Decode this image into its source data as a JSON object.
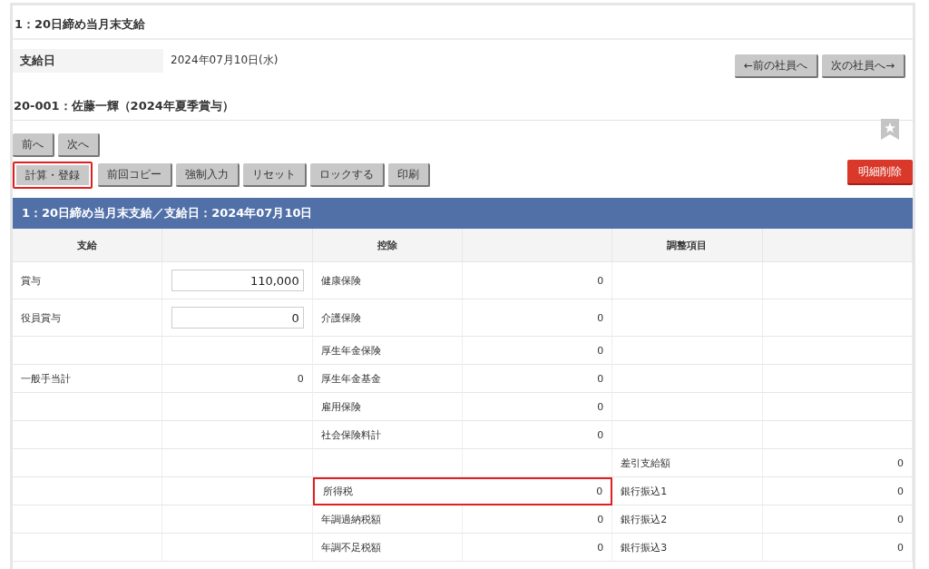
{
  "section_title": "1：20日締め当月末支給",
  "pay_date": {
    "label": "支給日",
    "value": "2024年07月10日(水)"
  },
  "employee_nav": [
    "←前の社員へ",
    "次の社員へ→"
  ],
  "employee_title": "20-001：佐藤一輝（2024年夏季賞与）",
  "page_nav": [
    "前へ",
    "次へ"
  ],
  "actions": [
    {
      "label": "計算・登録",
      "highlighted": true
    },
    {
      "label": "前回コピー",
      "highlighted": false
    },
    {
      "label": "強制入力",
      "highlighted": false
    },
    {
      "label": "リセット",
      "highlighted": false
    },
    {
      "label": "ロックする",
      "highlighted": false
    },
    {
      "label": "印刷",
      "highlighted": false
    }
  ],
  "delete_button": "明細削除",
  "table": {
    "title": "1：20日締め当月末支給／支給日：2024年07月10日",
    "headers": [
      "支給",
      "控除",
      "調整項目"
    ],
    "rows": [
      {
        "cells": [
          {
            "label": "賞与",
            "value": "110,000",
            "kind": "input",
            "highlighted": false
          },
          {
            "label": "健康保険",
            "value": "0",
            "kind": "text",
            "highlighted": false
          },
          {}
        ]
      },
      {
        "cells": [
          {
            "label": "役員賞与",
            "value": "0",
            "kind": "input",
            "highlighted": false
          },
          {
            "label": "介護保険",
            "value": "0",
            "kind": "text",
            "highlighted": false
          },
          {}
        ]
      },
      {
        "cells": [
          {},
          {
            "label": "厚生年金保険",
            "value": "0",
            "kind": "text",
            "highlighted": false
          },
          {}
        ]
      },
      {
        "cells": [
          {
            "label": "一般手当計",
            "value": "0",
            "kind": "text",
            "highlighted": false
          },
          {
            "label": "厚生年金基金",
            "value": "0",
            "kind": "text",
            "highlighted": false
          },
          {}
        ]
      },
      {
        "cells": [
          {},
          {
            "label": "雇用保険",
            "value": "0",
            "kind": "text",
            "highlighted": false
          },
          {}
        ]
      },
      {
        "cells": [
          {},
          {
            "label": "社会保険料計",
            "value": "0",
            "kind": "text",
            "highlighted": false
          },
          {}
        ]
      },
      {
        "cells": [
          {},
          {},
          {
            "label": "差引支給額",
            "value": "0",
            "kind": "text",
            "highlighted": false
          }
        ]
      },
      {
        "cells": [
          {},
          {
            "label": "所得税",
            "value": "0",
            "kind": "text",
            "highlighted": true
          },
          {
            "label": "銀行振込1",
            "value": "0",
            "kind": "text",
            "highlighted": false
          }
        ]
      },
      {
        "cells": [
          {},
          {
            "label": "年調過納税額",
            "value": "0",
            "kind": "text",
            "highlighted": false
          },
          {
            "label": "銀行振込2",
            "value": "0",
            "kind": "text",
            "highlighted": false
          }
        ]
      },
      {
        "cells": [
          {},
          {
            "label": "年調不足税額",
            "value": "0",
            "kind": "text",
            "highlighted": false
          },
          {
            "label": "銀行振込3",
            "value": "0",
            "kind": "text",
            "highlighted": false
          }
        ]
      }
    ]
  }
}
